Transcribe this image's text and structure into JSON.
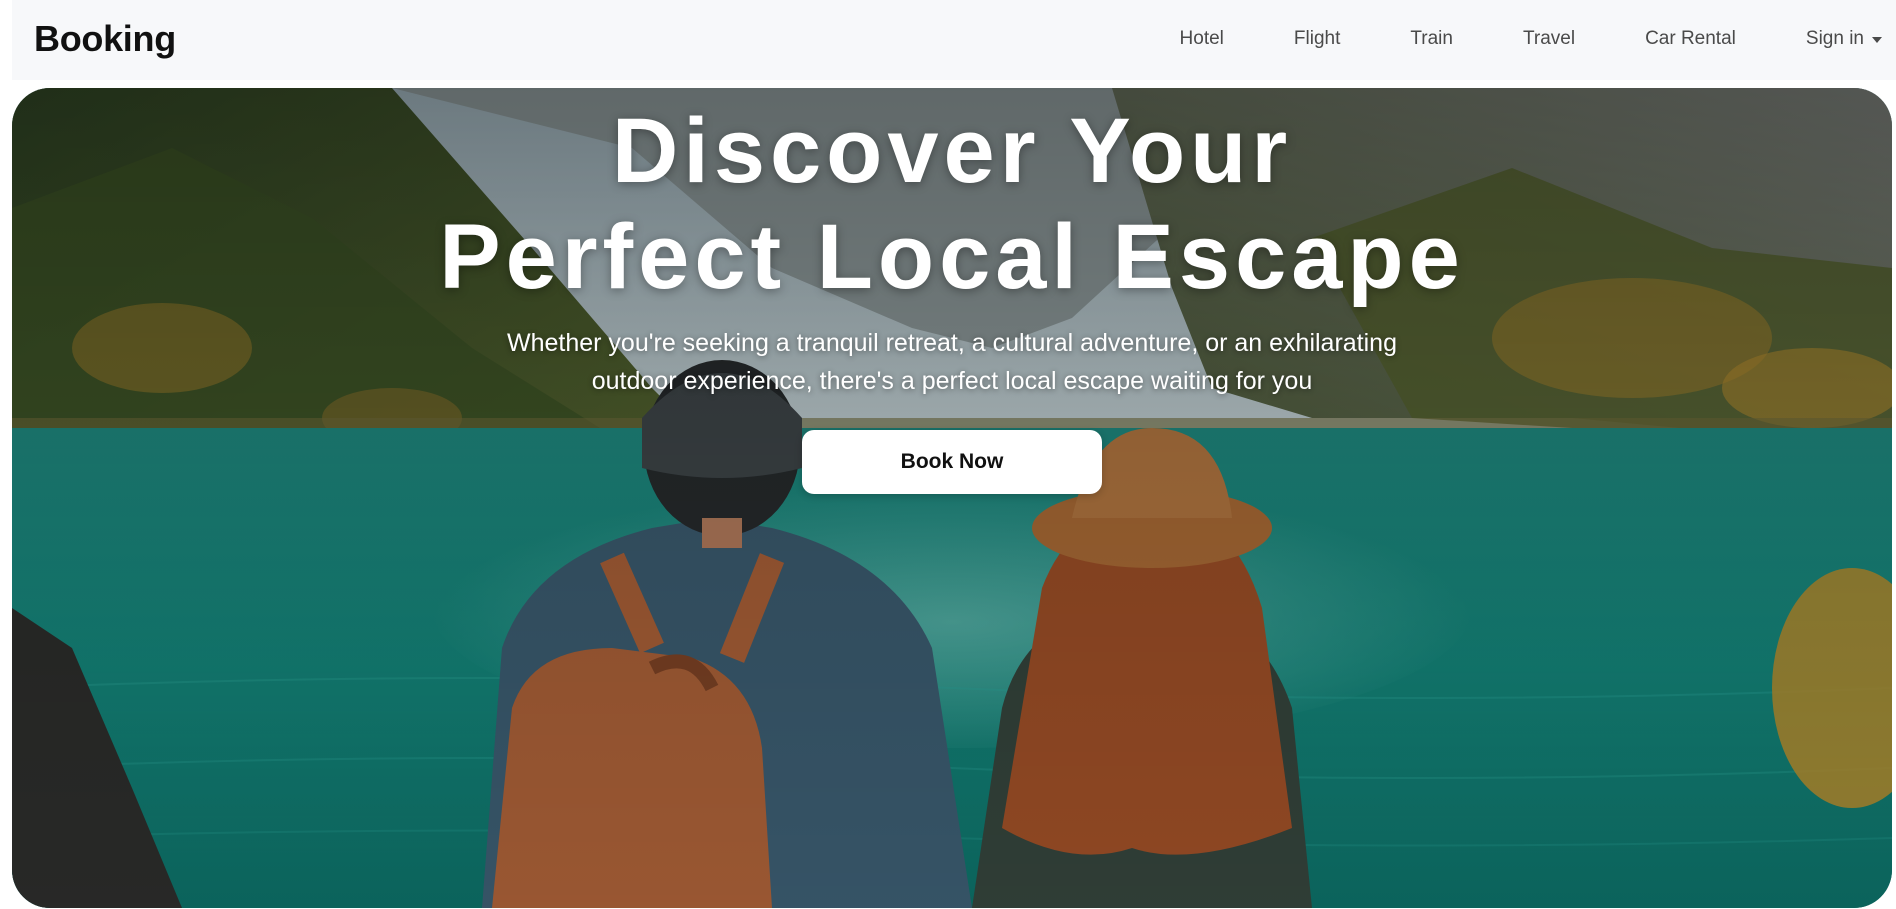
{
  "navbar": {
    "brand": "Booking",
    "links": [
      "Hotel",
      "Flight",
      "Train",
      "Travel",
      "Car Rental"
    ],
    "signin_label": "Sign in"
  },
  "hero": {
    "title_line1": "Discover Your",
    "title_line2": "Perfect Local Escape",
    "subtitle": "Whether you're seeking a tranquil retreat, a cultural adventure, or an exhilarating outdoor experience, there's a perfect local escape waiting for you",
    "cta_label": "Book Now",
    "image_description": "two travelers with backpack and hat overlooking turquoise mountain lake",
    "colors": {
      "lake": "#1b8a7f",
      "deep_water": "#0e5a55",
      "mountain": "#6f7778",
      "forest": "#3f5a2a",
      "autumn_trees": "#b88a2c",
      "backpack": "#b0643a",
      "hat": "#b8763e",
      "hair": "#a8552a"
    }
  }
}
